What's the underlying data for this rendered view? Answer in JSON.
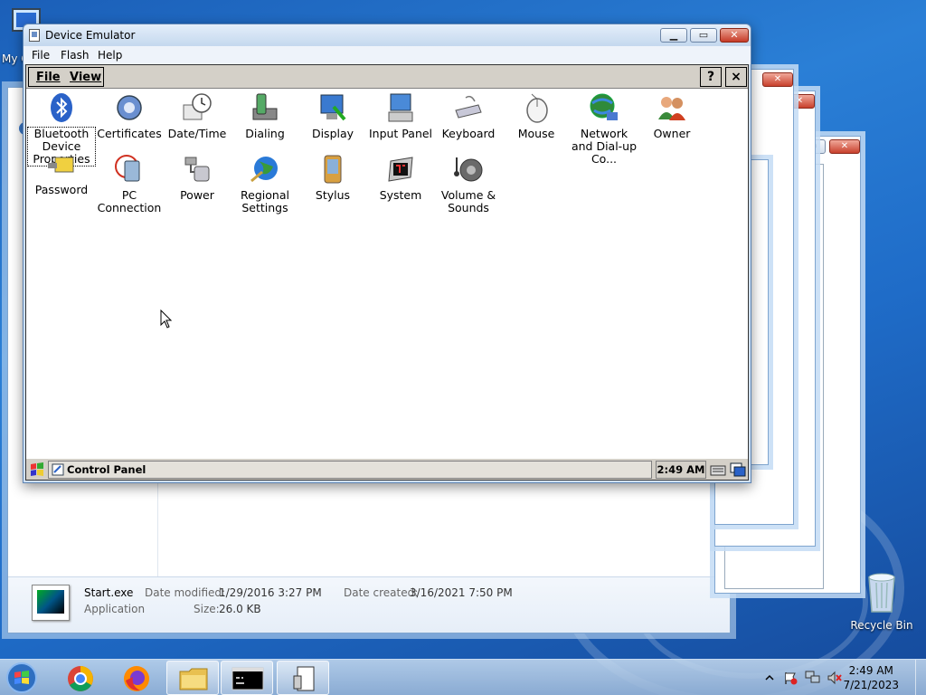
{
  "desktop": {
    "my_computer_label": "My C",
    "recycle_bin_label": "Recycle Bin"
  },
  "explorer_details": {
    "file_name": "Start.exe",
    "file_type": "Application",
    "modified_key": "Date modified:",
    "modified_value": "1/29/2016 3:27 PM",
    "size_key": "Size:",
    "size_value": "26.0 KB",
    "created_key": "Date created:",
    "created_value": "3/16/2021 7:50 PM"
  },
  "emulator": {
    "title": "Device Emulator",
    "menu": [
      "File",
      "Flash",
      "Help"
    ],
    "ce_menu": [
      "File",
      "View"
    ],
    "ce_help": "?",
    "ce_close": "×",
    "icons": [
      {
        "label": "Bluetooth Device Properties",
        "icon": "bluetooth-icon"
      },
      {
        "label": "Certificates",
        "icon": "certificate-icon"
      },
      {
        "label": "Date/Time",
        "icon": "clock-icon"
      },
      {
        "label": "Dialing",
        "icon": "phone-icon"
      },
      {
        "label": "Display",
        "icon": "display-icon"
      },
      {
        "label": "Input Panel",
        "icon": "input-panel-icon"
      },
      {
        "label": "Keyboard",
        "icon": "keyboard-icon"
      },
      {
        "label": "Mouse",
        "icon": "mouse-icon"
      },
      {
        "label": "Network and Dial-up Co...",
        "icon": "network-icon"
      },
      {
        "label": "Owner",
        "icon": "owner-icon"
      },
      {
        "label": "Password",
        "icon": "password-icon"
      },
      {
        "label": "PC Connection",
        "icon": "pc-connection-icon"
      },
      {
        "label": "Power",
        "icon": "power-icon"
      },
      {
        "label": "Regional Settings",
        "icon": "globe-icon"
      },
      {
        "label": "Stylus",
        "icon": "stylus-icon"
      },
      {
        "label": "System",
        "icon": "system-icon"
      },
      {
        "label": "Volume & Sounds",
        "icon": "speaker-icon"
      }
    ],
    "taskbar_item": "Control Panel",
    "ce_clock": "2:49 AM"
  },
  "taskbar": {
    "time": "2:49 AM",
    "date": "7/21/2023"
  },
  "colors": {
    "accent": "#1f6cc8",
    "close_red": "#c63a26"
  }
}
